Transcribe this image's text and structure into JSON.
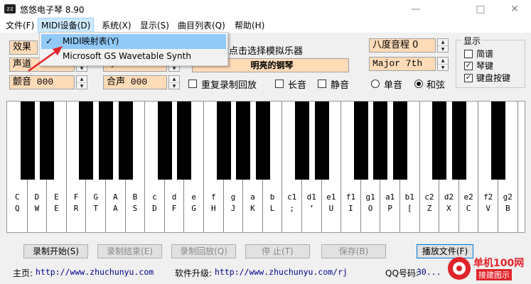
{
  "window": {
    "title": "悠悠电子琴 8.90",
    "app_icon": "zz",
    "minimize": "—",
    "maximize": "□",
    "close": "✕"
  },
  "menu": [
    "文件(F)",
    "MIDI设备(D)",
    "系统(X)",
    "显示(S)",
    "曲目列表(Q)",
    "帮助(H)"
  ],
  "midi_menu": {
    "items": [
      "MIDI映射表(Y)",
      "Microsoft GS Wavetable Synth"
    ],
    "checked_glyph": "✓"
  },
  "controls": {
    "effect": "效果",
    "channel": "声道",
    "vibrato": "颤音 000",
    "voice_partial": "琴",
    "chorus": "合声 000",
    "hint": "点击选择模拟乐器",
    "instrument": "明亮的钢琴",
    "octave": "八度音程 0",
    "chord_type": "Major 7th",
    "repeat_record": "重复录制回放",
    "long_tone": "长音",
    "mute": "静音",
    "single_note": "单音",
    "chord": "和弦"
  },
  "display": {
    "title": "显示",
    "sheet": "简谱",
    "keys": "琴键",
    "keyboard_keys": "键盘按键"
  },
  "keyboard": {
    "notes": [
      "C",
      "D",
      "E",
      "F",
      "G",
      "A",
      "B",
      "c",
      "d",
      "e",
      "f",
      "g",
      "a",
      "b",
      "c1",
      "d1",
      "e1",
      "f1",
      "g1",
      "a1",
      "b1",
      "c2",
      "d2",
      "e2",
      "f2",
      "g2"
    ],
    "keys": [
      "Q",
      "W",
      "E",
      "R",
      "T",
      "A",
      "S",
      "D",
      "F",
      "G",
      "H",
      "J",
      "K",
      "L",
      ";",
      "’",
      "U",
      "I",
      "O",
      "P",
      "[",
      "Z",
      "X",
      "C",
      "V",
      "B"
    ]
  },
  "buttons": [
    "录制开始(S)",
    "录制结束(E)",
    "录制回放(Q)",
    "停 止(T)",
    "保存(B)",
    "播放文件(F)"
  ],
  "footer": {
    "home_label": "主页:",
    "home_url": "http://www.zhuchunyu.com",
    "update_label": "软件升级:",
    "update_url": "http://www.zhuchunyu.com/rj",
    "qq_label": "QQ号码:",
    "qq": "30..."
  },
  "watermark": {
    "line1": "单机100网",
    "line2": "接建图示"
  },
  "colors": {
    "control_bg": "#ffdbb8",
    "menu_highlight": "#91c9f7",
    "arrow": "#e0242a",
    "watermark": "#e0242a"
  }
}
